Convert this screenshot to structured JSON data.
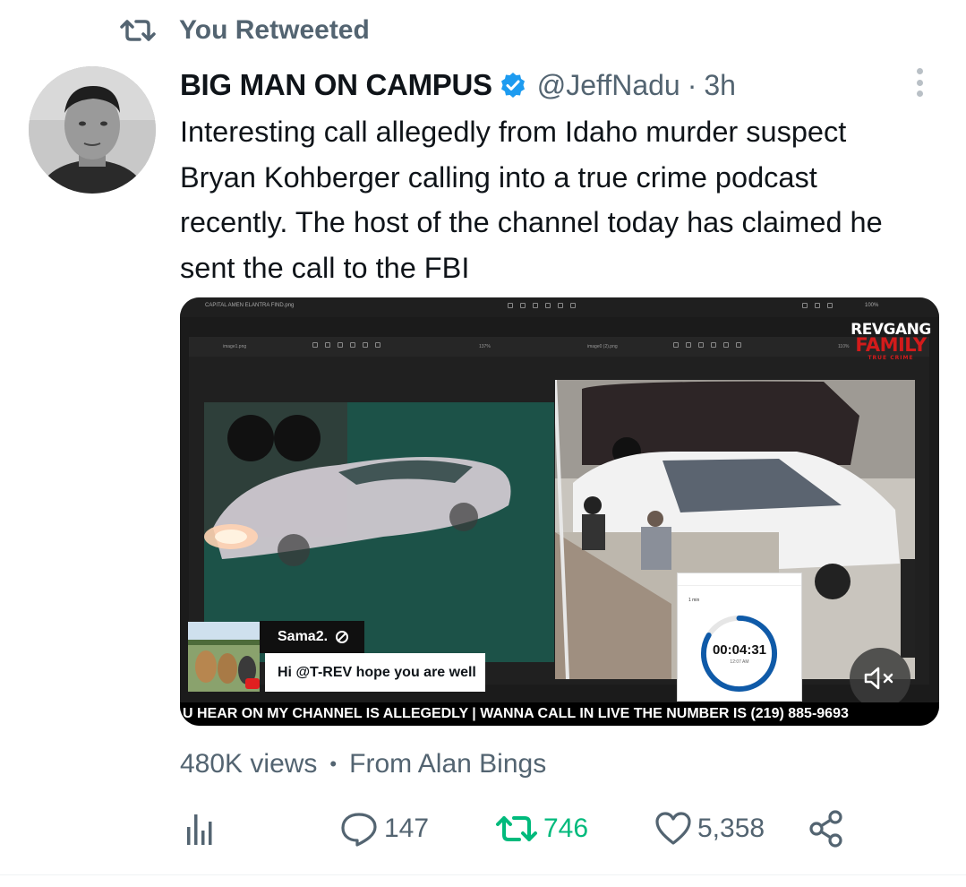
{
  "retweet_context": {
    "label": "You Retweeted",
    "icon": "retweet-icon"
  },
  "author": {
    "display_name": "BIG MAN ON CAMPUS",
    "verified": true,
    "handle": "@JeffNadu",
    "separator": "·",
    "time": "3h"
  },
  "tweet": {
    "text": "Interesting call allegedly from Idaho murder suspect Bryan Kohberger calling into a true crime podcast recently. The host of the channel today has claimed he sent the call to the FBI"
  },
  "media": {
    "overlay_brand": {
      "line1": "REVGANG",
      "line2": "FAMILY",
      "line3": "TRUE CRIME"
    },
    "chat": {
      "user": "Sama2.",
      "message": "Hi @T-REV hope you are well"
    },
    "timer": {
      "label": "1 min",
      "value": "00:04:31",
      "sub": "12:07 AM"
    },
    "ticker": "U HEAR ON MY CHANNEL IS ALLEGEDLY | WANNA CALL IN LIVE THE NUMBER IS (219) 885-9693",
    "file_left": "image1.png",
    "file_right": "image0 (2).png",
    "file_title": "CAPITAL AMEN ELANTRA FIND.png",
    "zoom_left": "137%",
    "zoom_right": "110%",
    "zoom_top": "100%",
    "mute_icon": "speaker-muted-icon"
  },
  "meta": {
    "views": "480K views",
    "sep": "•",
    "source": "From Alan Bings"
  },
  "actions": {
    "analytics_icon": "bar-chart-icon",
    "replies": "147",
    "retweets": "746",
    "likes": "5,358",
    "share_icon": "share-icon"
  },
  "colors": {
    "accent_blue": "#1d9bf0",
    "retweet_green": "#00ba7c",
    "muted_text": "#536471",
    "brand_red": "#d21b1b"
  }
}
